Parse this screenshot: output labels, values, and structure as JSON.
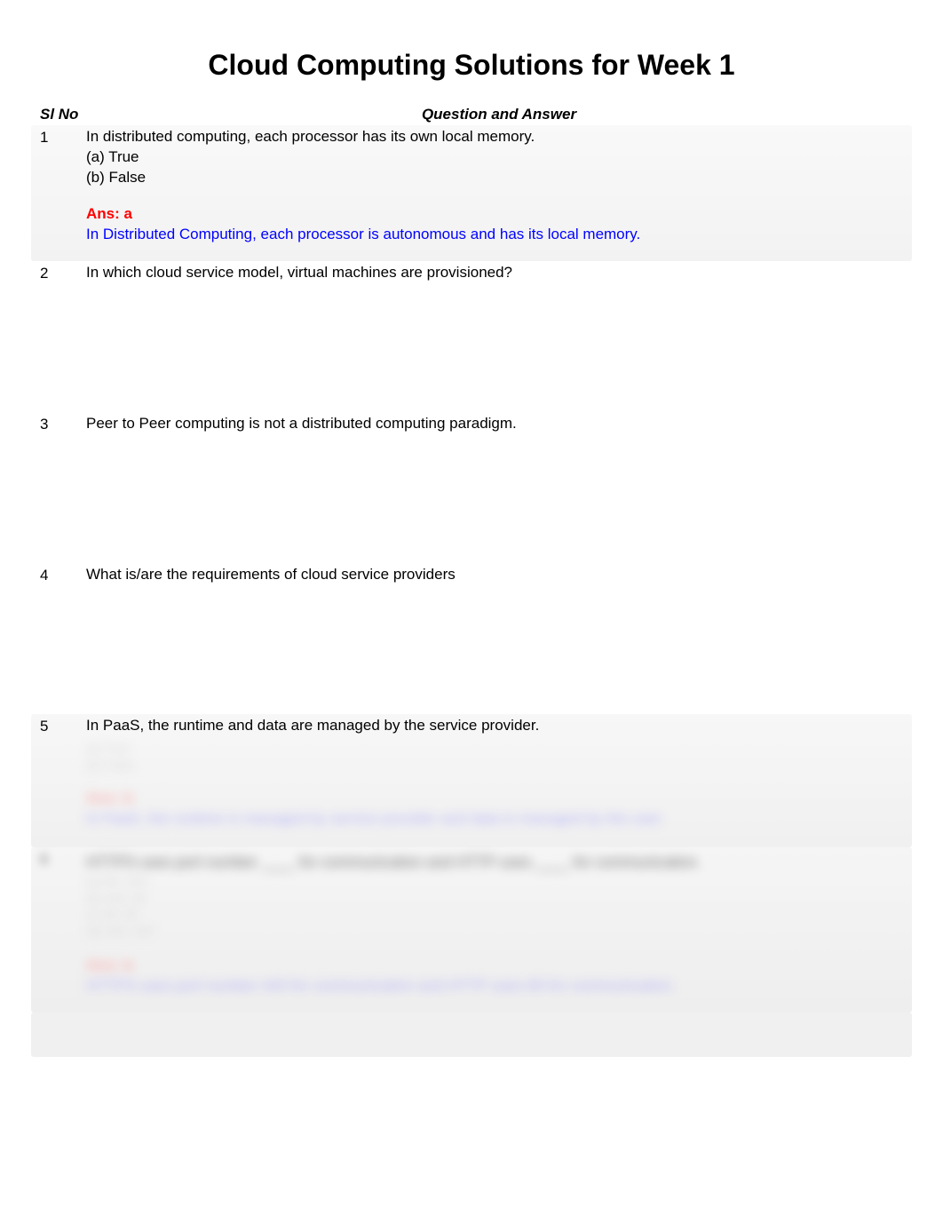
{
  "title": "Cloud Computing Solutions for Week 1",
  "headers": {
    "slno": "Sl No",
    "qa": "Question and Answer"
  },
  "rows": [
    {
      "num": "1",
      "question": "In distributed computing, each processor has its own local memory.",
      "options": [
        "(a) True",
        "(b) False"
      ],
      "ans_label": "Ans:  a",
      "explanation": "In Distributed Computing, each processor is autonomous and has its local memory."
    },
    {
      "num": "2",
      "question": "In which cloud service model, virtual machines are provisioned?",
      "options": [],
      "ans_label": "",
      "explanation": ""
    },
    {
      "num": "3",
      "question": "Peer to Peer computing is not a distributed computing paradigm.",
      "options": [],
      "ans_label": "",
      "explanation": ""
    },
    {
      "num": "4",
      "question": "What is/are the requirements of cloud service providers",
      "options": [],
      "ans_label": "",
      "explanation": ""
    },
    {
      "num": "5",
      "question": "In PaaS, the runtime and data are managed by the service provider.",
      "blur_opts": [
        "(a) True",
        "(b) False"
      ],
      "blur_ans": "Ans:  b",
      "blur_exp": "In PaaS, the runtime is managed by service provider and data is managed by the user."
    }
  ],
  "row6": {
    "num": "6",
    "blur_q": "HTTPS uses port number ____ for communication and HTTP uses ____ for communication.",
    "blur_opts": [
      "(a) 80, 443",
      "(b) 443, 80",
      "(c) 80, 80",
      "(d) 443, 443"
    ],
    "blur_ans": "Ans:  b",
    "blur_exp": "HTTPS uses port number 443 for communication and HTTP uses 80 for communication."
  }
}
